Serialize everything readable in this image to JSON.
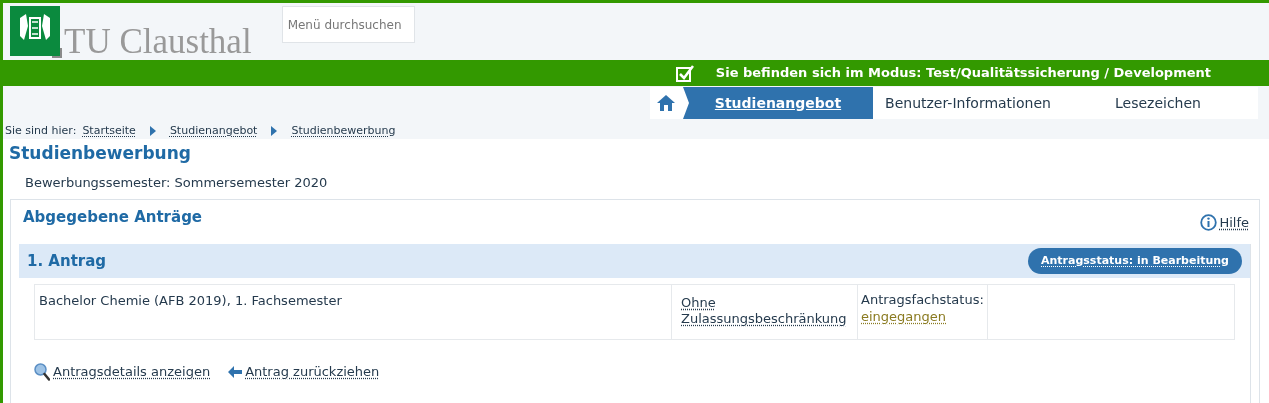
{
  "header": {
    "logo_text": "TU Clausthal",
    "search": {
      "placeholder": "Menü durchsuchen"
    }
  },
  "mode_bar": {
    "text": "Sie befinden sich im Modus: Test/Qualitätssicherung / Development",
    "checked": true
  },
  "nav_tabs": [
    {
      "label": "Studienangebot",
      "selected": true
    },
    {
      "label": "Benutzer-Informationen",
      "selected": false
    },
    {
      "label": "Lesezeichen",
      "selected": false
    }
  ],
  "breadcrumb": {
    "label": "Sie sind hier:",
    "items": [
      "Startseite",
      "Studienangebot",
      "Studienbewerbung"
    ]
  },
  "page_title": "Studienbewerbung",
  "semester": "Bewerbungssemester: Sommersemester 2020",
  "section": {
    "title": "Abgegebene Anträge",
    "help": "Hilfe",
    "applications": [
      {
        "title": "1. Antrag",
        "status": "Antragsstatus: in Bearbeitung",
        "subject": "Bachelor Chemie (AFB 2019), 1. Fachsemester",
        "restriction": "Ohne Zulassungsbeschränkung",
        "subject_status_label": "Antragsfachstatus:",
        "subject_status": "eingegangen",
        "actions": [
          {
            "kind": "details",
            "label": "Antragsdetails anzeigen"
          },
          {
            "kind": "withdraw",
            "label": "Antrag zurückziehen"
          }
        ]
      }
    ]
  }
}
